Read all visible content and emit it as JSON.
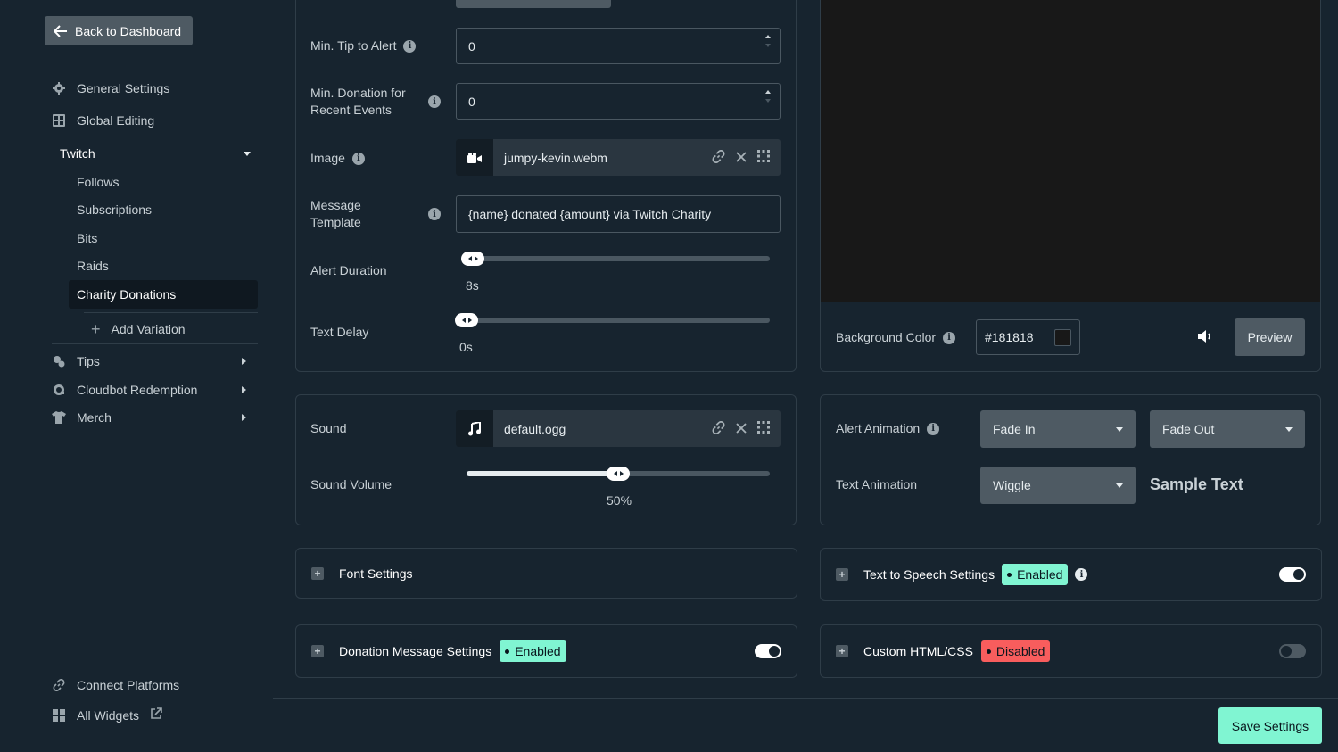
{
  "sidebar": {
    "back_label": "Back to Dashboard",
    "general_settings": "General Settings",
    "global_editing": "Global Editing",
    "twitch": "Twitch",
    "twitch_items": [
      "Follows",
      "Subscriptions",
      "Bits",
      "Raids",
      "Charity Donations"
    ],
    "add_variation": "Add Variation",
    "tips": "Tips",
    "cloudbot": "Cloudbot Redemption",
    "merch": "Merch",
    "connect_platforms": "Connect Platforms",
    "all_widgets": "All Widgets"
  },
  "alert_settings": {
    "min_tip_label": "Min. Tip to Alert",
    "min_tip_value": "0",
    "min_donation_label_1": "Min. Donation for",
    "min_donation_label_2": "Recent Events",
    "min_donation_value": "0",
    "image_label": "Image",
    "image_file": "jumpy-kevin.webm",
    "message_template_label_1": "Message",
    "message_template_label_2": "Template",
    "message_template_value": "{name} donated {amount} via Twitch Charity",
    "alert_duration_label": "Alert Duration",
    "alert_duration_value": "8s",
    "alert_duration_level": 0.02,
    "text_delay_label": "Text Delay",
    "text_delay_value": "0s",
    "text_delay_level": 0
  },
  "sound": {
    "sound_label": "Sound",
    "sound_file": "default.ogg",
    "volume_label": "Sound Volume",
    "volume_value": "50%",
    "volume_level": 0.5
  },
  "preview": {
    "bg_color_label": "Background Color",
    "bg_color_value": "#181818",
    "preview_button": "Preview"
  },
  "animation": {
    "alert_animation_label": "Alert Animation",
    "fade_in": "Fade In",
    "fade_out": "Fade Out",
    "text_animation_label": "Text Animation",
    "text_anim_value": "Wiggle",
    "sample_text": "Sample Text"
  },
  "sections": {
    "font_settings": "Font Settings",
    "tts_settings": "Text to Speech Settings",
    "tts_status": "Enabled",
    "donation_msg_settings": "Donation Message Settings",
    "donation_msg_status": "Enabled",
    "custom_html": "Custom HTML/CSS",
    "custom_html_status": "Disabled"
  },
  "footer": {
    "save_button": "Save Settings"
  },
  "colors": {
    "background": "#17242f",
    "accent": "#80f5d2",
    "danger": "#f85d5d",
    "button_gray": "#4e5a63"
  },
  "icons": [
    "arrow-left-icon",
    "gear-icon",
    "grid-icon",
    "caret-down-icon",
    "plus-icon",
    "tips-icon",
    "cloudbot-icon",
    "shirt-icon",
    "link-icon",
    "widgets-icon",
    "external-link-icon",
    "info-icon",
    "video-icon",
    "music-icon",
    "close-icon",
    "drag-icon",
    "volume-icon"
  ]
}
